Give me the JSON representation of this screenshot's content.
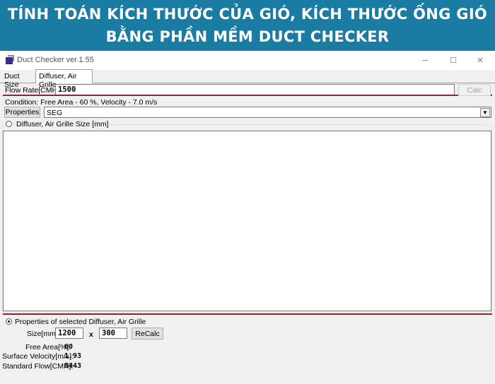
{
  "banner": {
    "line1": "TÍNH TOÁN KÍCH THƯỚC CỦA GIÓ, KÍCH THƯỚC ỐNG GIÓ",
    "line2": "BẰNG PHẦN MỀM DUCT CHECKER"
  },
  "window": {
    "title": "Duct Checker ver.1.55",
    "buttons": {
      "minimize": "─",
      "maximize": "☐",
      "close": "✕"
    }
  },
  "tabs": [
    {
      "label": "Duct Size"
    },
    {
      "label": "Diffuser, Air Grille"
    }
  ],
  "flow_rate": {
    "label": "Flow Rate[CMH]:",
    "value": "1500",
    "calc_label": "Calc"
  },
  "condition": "Condition: Free Area - 60 %, Velocity - 7.0 m/s",
  "properties": {
    "button_label": "Properties",
    "select_value": "SEG",
    "arrow": "▼"
  },
  "size_group": {
    "label": "Diffuser, Air Grille Size [mm]"
  },
  "selected": {
    "label": "Properties of selected Diffuser, Air Grille",
    "size_label": "Size[mm]:",
    "width": "1200",
    "x_label": "x",
    "height": "300",
    "recalc_label": "ReCalc",
    "free_area_label": "Free Area[%]:",
    "free_area": "60",
    "surface_velocity_label": "Surface Velocity[m/s]:",
    "surface_velocity": "1.93",
    "standard_flow_label": "Standard Flow[CMH]:",
    "standard_flow": "5443"
  }
}
